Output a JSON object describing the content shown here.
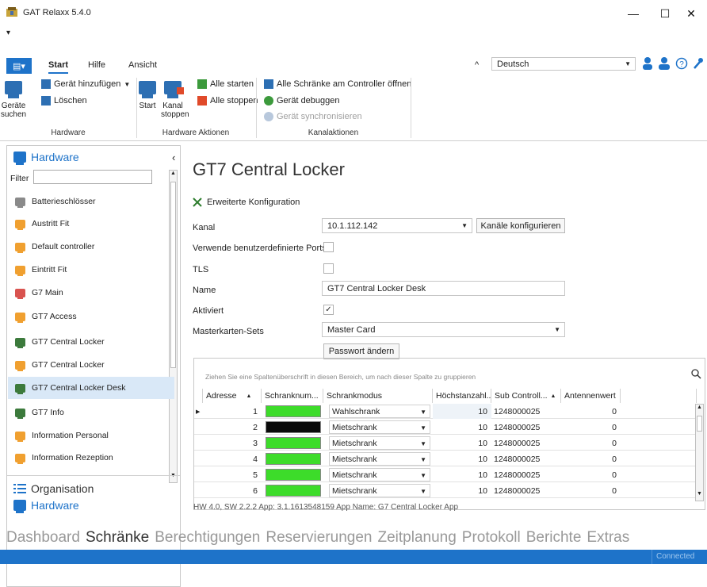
{
  "window": {
    "title": "GAT Relaxx 5.4.0",
    "minimize": "—",
    "maximize": "☐",
    "close": "✕",
    "qat_arrow": "▾"
  },
  "ribbon": {
    "file_icon": "▤▾",
    "tabs": [
      "Start",
      "Hilfe",
      "Ansicht"
    ],
    "collapse_arrow": "^",
    "language": "Deutsch",
    "groups": {
      "hardware": {
        "label": "Hardware",
        "big_button": "Geräte suchen",
        "add_device": "Gerät hinzufügen",
        "delete": "Löschen"
      },
      "hardware_actions": {
        "label": "Hardware Aktionen",
        "start": "Start",
        "stop_channel": "Kanal stoppen",
        "start_all": "Alle starten",
        "stop_all": "Alle stoppen"
      },
      "channel_actions": {
        "label": "Kanalaktionen",
        "open_all": "Alle Schränke am Controller öffnen",
        "debug": "Gerät debuggen",
        "sync": "Gerät synchronisieren"
      }
    }
  },
  "sidebar": {
    "header": "Hardware",
    "collapse": "‹",
    "filter_label": "Filter",
    "filter_value": "",
    "items": [
      {
        "label": "Batterieschlösser",
        "color": "#8a8a8a"
      },
      {
        "label": "Austritt Fit",
        "color": "#f0a030"
      },
      {
        "label": "Default controller",
        "color": "#f0a030"
      },
      {
        "label": "Eintritt Fit",
        "color": "#f0a030"
      },
      {
        "label": "G7 Main",
        "color": "#d9534f"
      },
      {
        "label": "GT7 Access",
        "color": "#f0a030"
      },
      {
        "label": "GT7 Central Locker",
        "color": "#3c7a3c"
      },
      {
        "label": "GT7 Central Locker",
        "color": "#f0a030"
      },
      {
        "label": "GT7 Central Locker Desk",
        "color": "#3c7a3c"
      },
      {
        "label": "GT7 Info",
        "color": "#3c7a3c"
      },
      {
        "label": "Information Personal",
        "color": "#f0a030"
      },
      {
        "label": "Information Rezeption",
        "color": "#f0a030"
      }
    ],
    "bottom_nav": [
      {
        "label": "Organisation"
      },
      {
        "label": "Hardware"
      }
    ]
  },
  "detail": {
    "title": "GT7 Central Locker",
    "advanced_config": "Erweiterte Konfiguration",
    "labels": {
      "channel": "Kanal",
      "custom_ports": "Verwende benutzerdefinierte Ports",
      "tls": "TLS",
      "name": "Name",
      "enabled": "Aktiviert",
      "master_sets": "Masterkarten-Sets"
    },
    "channel_value": "10.1.112.142",
    "configure_channels": "Kanäle konfigurieren",
    "custom_ports_checked": false,
    "tls_checked": false,
    "name_value": "GT7 Central Locker Desk",
    "enabled_checked": true,
    "enabled_mark": "✓",
    "master_sets_value": "Master Card",
    "change_password": "Passwort ändern",
    "footer": "HW 4.0, SW 2.2.2 App: 3.1.1613548159 App Name: G7 Central Locker App"
  },
  "grid": {
    "group_hint": "Ziehen Sie eine Spaltenüberschrift in diesen Bereich, um nach dieser Spalte zu gruppieren",
    "columns": [
      "Adresse",
      "Schranknum...",
      "Schrankmodus",
      "Höchstanzahl...",
      "Sub Controll...",
      "Antennenwert"
    ],
    "rows": [
      {
        "address": "1",
        "color": "#3ddc2a",
        "mode": "Wahlschrank",
        "max": "10",
        "sub": "1248000025",
        "antenna": "0"
      },
      {
        "address": "2",
        "color": "#0a0a0a",
        "mode": "Mietschrank",
        "max": "10",
        "sub": "1248000025",
        "antenna": "0"
      },
      {
        "address": "3",
        "color": "#3ddc2a",
        "mode": "Mietschrank",
        "max": "10",
        "sub": "1248000025",
        "antenna": "0"
      },
      {
        "address": "4",
        "color": "#3ddc2a",
        "mode": "Mietschrank",
        "max": "10",
        "sub": "1248000025",
        "antenna": "0"
      },
      {
        "address": "5",
        "color": "#3ddc2a",
        "mode": "Mietschrank",
        "max": "10",
        "sub": "1248000025",
        "antenna": "0"
      },
      {
        "address": "6",
        "color": "#3ddc2a",
        "mode": "Mietschrank",
        "max": "10",
        "sub": "1248000025",
        "antenna": "0"
      }
    ]
  },
  "bottom_tabs": [
    "Dashboard",
    "Schränke",
    "Berechtigungen",
    "Reservierungen",
    "Zeitplanung",
    "Protokoll",
    "Berichte",
    "Extras"
  ],
  "bottom_tabs_active": "Schränke",
  "status": "Connected",
  "colors": {
    "accent": "#1e73c9",
    "status_bar": "#1e73c9"
  }
}
